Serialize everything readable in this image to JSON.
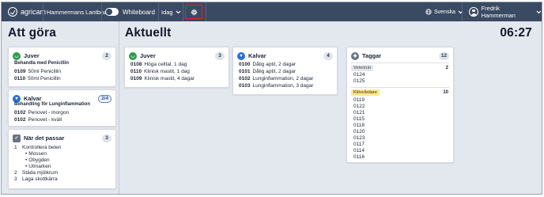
{
  "topbar": {
    "logo_text": "agricam",
    "farm_name": "Hammermans Lantbruk",
    "whiteboard_label": "Whiteboard",
    "day_select": "Idag",
    "language": "Svenska",
    "user_name": "Fredrik Hammerman"
  },
  "left": {
    "title": "Att göra",
    "cards": [
      {
        "title": "Juver",
        "badge": "2",
        "subtitle": "Behandla med Penicillin",
        "items": [
          {
            "id": "0109",
            "text": "50ml Penicillin"
          },
          {
            "id": "0110",
            "text": "50ml Penicillin"
          }
        ]
      },
      {
        "title": "Kalvar",
        "badge": "2/4",
        "subtitle": "Behandling för Lunginflammation",
        "items": [
          {
            "id": "0102",
            "text": "Penovet - morgon"
          },
          {
            "id": "0102",
            "text": "Penovet - kväll"
          }
        ]
      },
      {
        "title": "När det passar",
        "badge": "3",
        "list": [
          {
            "n": "1",
            "text": "Kontrollera beten"
          },
          {
            "sub": "Mossen"
          },
          {
            "sub": "Obygden"
          },
          {
            "sub": "Utmarken"
          },
          {
            "n": "2",
            "text": "Städa mjölkrum"
          },
          {
            "n": "3",
            "text": "Laga skottkärra"
          }
        ]
      }
    ]
  },
  "main": {
    "title": "Aktuellt",
    "clock": "06:27",
    "cards": [
      {
        "title": "Juver",
        "badge": "3",
        "items": [
          {
            "id": "0108",
            "text": "Höga celltal, 1 dag"
          },
          {
            "id": "0110",
            "text": "Klinisk mastit, 1 dag"
          },
          {
            "id": "0109",
            "text": "Klinisk mastit, 4 dagar"
          }
        ]
      },
      {
        "title": "Kalvar",
        "badge": "4",
        "items": [
          {
            "id": "0100",
            "text": "Dålig aptit, 2 dagar"
          },
          {
            "id": "0101",
            "text": "Dålig aptit, 2 dagar"
          },
          {
            "id": "0102",
            "text": "Lunginflammation, 2 dagar"
          },
          {
            "id": "0103",
            "text": "Lunginflammation, 3 dagar"
          }
        ]
      }
    ],
    "tags": {
      "title": "Taggar",
      "badge": "12",
      "groups": [
        {
          "label": "Veterinär",
          "count": "2",
          "ids": [
            "0124",
            "0125"
          ]
        },
        {
          "label": "Klövvårdare",
          "count": "10",
          "ids": [
            "0119",
            "0122",
            "0121",
            "0115",
            "0118",
            "0120",
            "0123",
            "0117",
            "0114",
            "0116"
          ]
        }
      ]
    }
  },
  "colors": {
    "topbar": "#3b4a63",
    "highlight": "#e1241c",
    "green_icon": "#2d9d4c",
    "blue_icon": "#2c6fd1",
    "tag_yellow": "#ffe88f"
  }
}
